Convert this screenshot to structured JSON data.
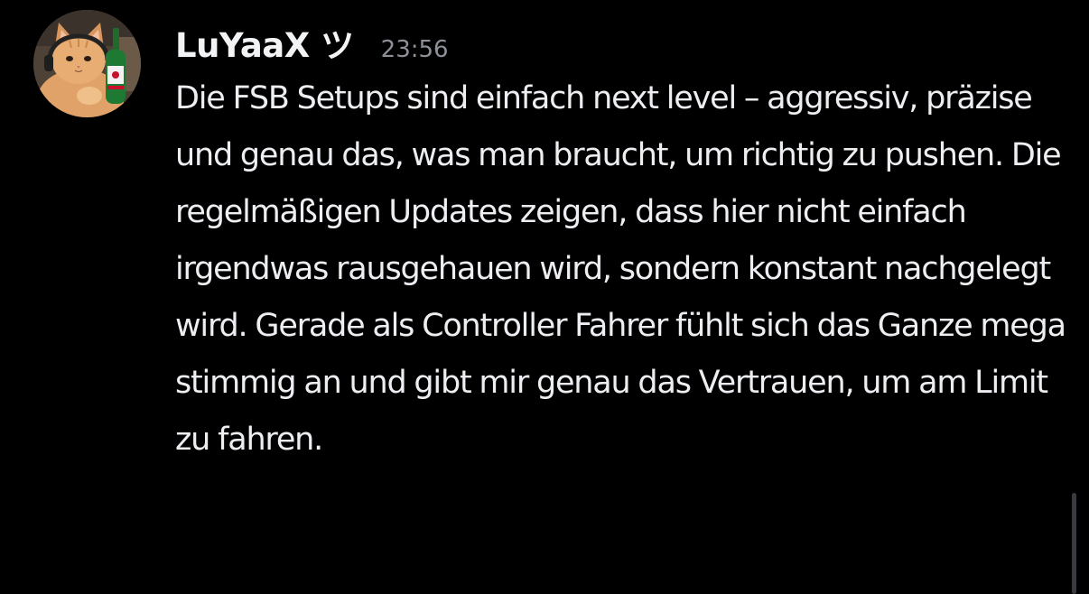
{
  "message": {
    "author": "LuYaaX ツ",
    "timestamp": "23:56",
    "text": "Die FSB Setups sind einfach next level – aggressiv, präzise und genau das, was man braucht, um richtig zu pushen. Die regelmäßigen Updates zeigen, dass hier nicht einfach irgendwas rausgehauen wird, sondern konstant nachgelegt wird. Gerade als Controller Fahrer fühlt sich das Ganze mega stimmig an und gibt mir genau das Vertrauen, um am Limit zu fahren.",
    "avatar_icon": "cat-with-beer-bottle-icon"
  },
  "colors": {
    "background": "#000000",
    "username": "#f2f3f5",
    "timestamp": "#8e9099",
    "text": "#eceef1",
    "scrollbar": "#3a3b40"
  }
}
